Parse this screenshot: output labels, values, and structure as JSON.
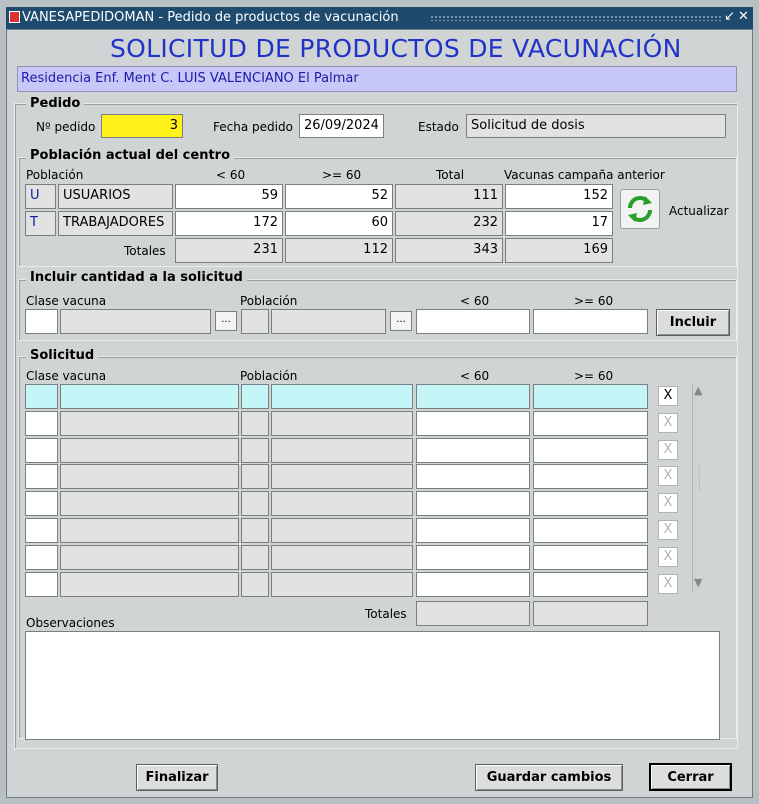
{
  "window": {
    "title": "VANESAPEDIDOMAN - Pedido de productos de vacunación"
  },
  "heading": "SOLICITUD DE PRODUCTOS DE VACUNACIÓN",
  "residence": "Residencia Enf. Ment C. LUIS VALENCIANO  El Palmar",
  "pedido": {
    "section": "Pedido",
    "num_label": "Nº pedido",
    "num": "3",
    "fecha_label": "Fecha pedido",
    "fecha": "26/09/2024",
    "estado_label": "Estado",
    "estado": "Solicitud de dosis"
  },
  "poblacion": {
    "section": "Población actual del centro",
    "col_poblacion": "Población",
    "col_lt60": "< 60",
    "col_ge60": ">= 60",
    "col_total": "Total",
    "col_prev": "Vacunas campaña anterior",
    "rows": [
      {
        "code": "U",
        "name": "USUARIOS",
        "lt60": "59",
        "ge60": "52",
        "total": "111",
        "prev": "152"
      },
      {
        "code": "T",
        "name": "TRABAJADORES",
        "lt60": "172",
        "ge60": "60",
        "total": "232",
        "prev": "17"
      }
    ],
    "totals_label": "Totales",
    "totals": {
      "lt60": "231",
      "ge60": "112",
      "total": "343",
      "prev": "169"
    },
    "refresh_label": "Actualizar"
  },
  "incluir": {
    "section": "Incluir cantidad a la solicitud",
    "col_clase": "Clase vacuna",
    "col_poblacion": "Población",
    "col_lt60": "< 60",
    "col_ge60": ">= 60",
    "lov1": "...",
    "lov2": "...",
    "button": "Incluir"
  },
  "solicitud": {
    "section": "Solicitud",
    "col_clase": "Clase vacuna",
    "col_poblacion": "Población",
    "col_lt60": "< 60",
    "col_ge60": ">= 60",
    "delete": "X",
    "totals_label": "Totales",
    "obs_label": "Observaciones"
  },
  "buttons": {
    "finalizar": "Finalizar",
    "guardar": "Guardar cambios",
    "cerrar": "Cerrar"
  },
  "colors": {
    "titlebar": "#1e4a6e",
    "heading": "#2033c8",
    "residence_bg": "#c8c8f8",
    "pedido_num_bg": "#fff21a",
    "active_row_bg": "#c4f6f8"
  }
}
